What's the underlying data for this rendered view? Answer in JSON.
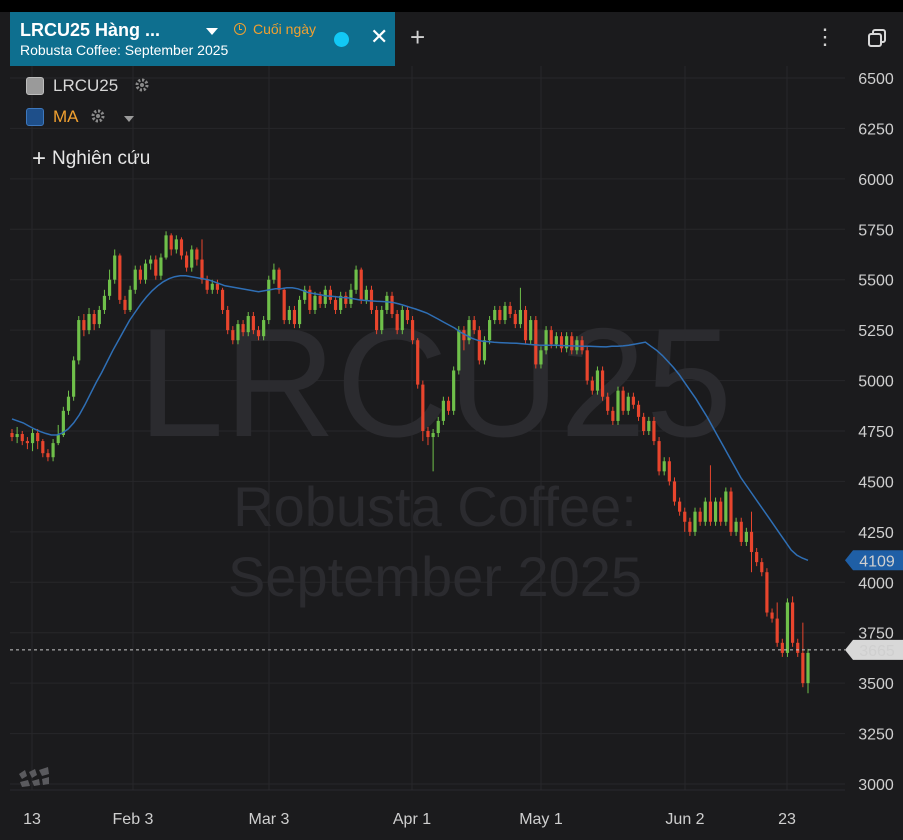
{
  "tab": {
    "title": "LRCU25 Hàng ...",
    "subtitle": "Robusta Coffee: September 2025",
    "timeframe": "Cuối ngày"
  },
  "legend": {
    "series_label": "LRCU25",
    "ma_label": "MA",
    "study_label": "Nghiên cứu",
    "ma_color": "#f0a030"
  },
  "watermark": {
    "symbol": "LRCU25",
    "line1": "Robusta Coffee:",
    "line2": "September 2025"
  },
  "colors": {
    "up": "#6fc04a",
    "down": "#e8452d",
    "ma": "#2f6fb5",
    "tab": "#0e6f8f",
    "last_price_badge": "#1f5fa6"
  },
  "chart_data": {
    "type": "candlestick",
    "y_ticks": [
      3000,
      3250,
      3500,
      3750,
      4000,
      4250,
      4500,
      4750,
      5000,
      5250,
      5500,
      5750,
      6000,
      6250,
      6500
    ],
    "ylim": [
      2950,
      6530
    ],
    "x_labels": [
      "13",
      "Feb 3",
      "Mar 3",
      "Apr 1",
      "May 1",
      "Jun 2",
      "23"
    ],
    "ma_last_value": "4109",
    "last_price_value": "3665",
    "last_price_line": 3665,
    "candles": [
      {
        "o": 4740,
        "c": 4720,
        "h": 4760,
        "l": 4700
      },
      {
        "o": 4720,
        "c": 4735,
        "h": 4770,
        "l": 4690
      },
      {
        "o": 4735,
        "c": 4700,
        "h": 4750,
        "l": 4680
      },
      {
        "o": 4700,
        "c": 4690,
        "h": 4720,
        "l": 4660
      },
      {
        "o": 4690,
        "c": 4740,
        "h": 4760,
        "l": 4650
      },
      {
        "o": 4740,
        "c": 4700,
        "h": 4760,
        "l": 4660
      },
      {
        "o": 4700,
        "c": 4640,
        "h": 4710,
        "l": 4620
      },
      {
        "o": 4640,
        "c": 4620,
        "h": 4660,
        "l": 4600
      },
      {
        "o": 4620,
        "c": 4690,
        "h": 4710,
        "l": 4600
      },
      {
        "o": 4690,
        "c": 4730,
        "h": 4780,
        "l": 4680
      },
      {
        "o": 4730,
        "c": 4850,
        "h": 4870,
        "l": 4720
      },
      {
        "o": 4850,
        "c": 4920,
        "h": 4950,
        "l": 4830
      },
      {
        "o": 4920,
        "c": 5100,
        "h": 5120,
        "l": 4900
      },
      {
        "o": 5100,
        "c": 5300,
        "h": 5320,
        "l": 5080
      },
      {
        "o": 5300,
        "c": 5250,
        "h": 5330,
        "l": 5220
      },
      {
        "o": 5250,
        "c": 5330,
        "h": 5360,
        "l": 5230
      },
      {
        "o": 5330,
        "c": 5280,
        "h": 5350,
        "l": 5250
      },
      {
        "o": 5280,
        "c": 5350,
        "h": 5370,
        "l": 5260
      },
      {
        "o": 5350,
        "c": 5420,
        "h": 5450,
        "l": 5330
      },
      {
        "o": 5420,
        "c": 5500,
        "h": 5550,
        "l": 5400
      },
      {
        "o": 5500,
        "c": 5620,
        "h": 5650,
        "l": 5480
      },
      {
        "o": 5620,
        "c": 5400,
        "h": 5630,
        "l": 5380
      },
      {
        "o": 5400,
        "c": 5350,
        "h": 5420,
        "l": 5330
      },
      {
        "o": 5350,
        "c": 5450,
        "h": 5470,
        "l": 5340
      },
      {
        "o": 5450,
        "c": 5550,
        "h": 5570,
        "l": 5430
      },
      {
        "o": 5550,
        "c": 5500,
        "h": 5570,
        "l": 5480
      },
      {
        "o": 5500,
        "c": 5580,
        "h": 5600,
        "l": 5480
      },
      {
        "o": 5580,
        "c": 5600,
        "h": 5620,
        "l": 5550
      },
      {
        "o": 5600,
        "c": 5520,
        "h": 5620,
        "l": 5500
      },
      {
        "o": 5520,
        "c": 5610,
        "h": 5630,
        "l": 5500
      },
      {
        "o": 5610,
        "c": 5720,
        "h": 5740,
        "l": 5600
      },
      {
        "o": 5720,
        "c": 5650,
        "h": 5730,
        "l": 5620
      },
      {
        "o": 5650,
        "c": 5700,
        "h": 5720,
        "l": 5630
      },
      {
        "o": 5700,
        "c": 5620,
        "h": 5710,
        "l": 5600
      },
      {
        "o": 5620,
        "c": 5560,
        "h": 5640,
        "l": 5540
      },
      {
        "o": 5560,
        "c": 5650,
        "h": 5670,
        "l": 5540
      },
      {
        "o": 5650,
        "c": 5600,
        "h": 5660,
        "l": 5570
      },
      {
        "o": 5600,
        "c": 5500,
        "h": 5700,
        "l": 5480
      },
      {
        "o": 5500,
        "c": 5450,
        "h": 5520,
        "l": 5430
      },
      {
        "o": 5450,
        "c": 5480,
        "h": 5500,
        "l": 5430
      },
      {
        "o": 5480,
        "c": 5450,
        "h": 5500,
        "l": 5430
      },
      {
        "o": 5450,
        "c": 5350,
        "h": 5460,
        "l": 5330
      },
      {
        "o": 5350,
        "c": 5250,
        "h": 5370,
        "l": 5230
      },
      {
        "o": 5250,
        "c": 5200,
        "h": 5270,
        "l": 5180
      },
      {
        "o": 5200,
        "c": 5280,
        "h": 5300,
        "l": 5180
      },
      {
        "o": 5280,
        "c": 5240,
        "h": 5300,
        "l": 5220
      },
      {
        "o": 5240,
        "c": 5320,
        "h": 5340,
        "l": 5220
      },
      {
        "o": 5320,
        "c": 5250,
        "h": 5340,
        "l": 5230
      },
      {
        "o": 5250,
        "c": 5220,
        "h": 5270,
        "l": 5200
      },
      {
        "o": 5220,
        "c": 5300,
        "h": 5320,
        "l": 5200
      },
      {
        "o": 5300,
        "c": 5500,
        "h": 5520,
        "l": 5280
      },
      {
        "o": 5500,
        "c": 5550,
        "h": 5580,
        "l": 5480
      },
      {
        "o": 5550,
        "c": 5450,
        "h": 5560,
        "l": 5430
      },
      {
        "o": 5450,
        "c": 5300,
        "h": 5460,
        "l": 5280
      },
      {
        "o": 5300,
        "c": 5350,
        "h": 5370,
        "l": 5280
      },
      {
        "o": 5350,
        "c": 5280,
        "h": 5370,
        "l": 5260
      },
      {
        "o": 5280,
        "c": 5400,
        "h": 5420,
        "l": 5260
      },
      {
        "o": 5400,
        "c": 5450,
        "h": 5470,
        "l": 5380
      },
      {
        "o": 5450,
        "c": 5350,
        "h": 5470,
        "l": 5330
      },
      {
        "o": 5350,
        "c": 5420,
        "h": 5440,
        "l": 5330
      },
      {
        "o": 5420,
        "c": 5380,
        "h": 5440,
        "l": 5360
      },
      {
        "o": 5380,
        "c": 5450,
        "h": 5470,
        "l": 5360
      },
      {
        "o": 5450,
        "c": 5400,
        "h": 5470,
        "l": 5380
      },
      {
        "o": 5400,
        "c": 5350,
        "h": 5420,
        "l": 5330
      },
      {
        "o": 5350,
        "c": 5420,
        "h": 5440,
        "l": 5330
      },
      {
        "o": 5420,
        "c": 5380,
        "h": 5440,
        "l": 5360
      },
      {
        "o": 5380,
        "c": 5450,
        "h": 5480,
        "l": 5360
      },
      {
        "o": 5450,
        "c": 5550,
        "h": 5570,
        "l": 5430
      },
      {
        "o": 5550,
        "c": 5400,
        "h": 5560,
        "l": 5380
      },
      {
        "o": 5400,
        "c": 5450,
        "h": 5470,
        "l": 5380
      },
      {
        "o": 5450,
        "c": 5350,
        "h": 5470,
        "l": 5330
      },
      {
        "o": 5350,
        "c": 5250,
        "h": 5370,
        "l": 5230
      },
      {
        "o": 5250,
        "c": 5350,
        "h": 5370,
        "l": 5230
      },
      {
        "o": 5350,
        "c": 5420,
        "h": 5440,
        "l": 5330
      },
      {
        "o": 5420,
        "c": 5330,
        "h": 5440,
        "l": 5310
      },
      {
        "o": 5330,
        "c": 5250,
        "h": 5350,
        "l": 5230
      },
      {
        "o": 5250,
        "c": 5350,
        "h": 5370,
        "l": 5230
      },
      {
        "o": 5350,
        "c": 5300,
        "h": 5370,
        "l": 5280
      },
      {
        "o": 5300,
        "c": 5200,
        "h": 5320,
        "l": 5180
      },
      {
        "o": 5200,
        "c": 4980,
        "h": 5210,
        "l": 4960
      },
      {
        "o": 4980,
        "c": 4750,
        "h": 5000,
        "l": 4700
      },
      {
        "o": 4750,
        "c": 4720,
        "h": 4770,
        "l": 4680
      },
      {
        "o": 4720,
        "c": 4740,
        "h": 4760,
        "l": 4550
      },
      {
        "o": 4740,
        "c": 4800,
        "h": 4820,
        "l": 4720
      },
      {
        "o": 4800,
        "c": 4900,
        "h": 4920,
        "l": 4780
      },
      {
        "o": 4900,
        "c": 4850,
        "h": 4920,
        "l": 4830
      },
      {
        "o": 4850,
        "c": 5050,
        "h": 5070,
        "l": 4830
      },
      {
        "o": 5050,
        "c": 5250,
        "h": 5270,
        "l": 5030
      },
      {
        "o": 5250,
        "c": 5200,
        "h": 5270,
        "l": 5150
      },
      {
        "o": 5200,
        "c": 5300,
        "h": 5320,
        "l": 5180
      },
      {
        "o": 5300,
        "c": 5250,
        "h": 5320,
        "l": 5230
      },
      {
        "o": 5250,
        "c": 5100,
        "h": 5270,
        "l": 5080
      },
      {
        "o": 5100,
        "c": 5200,
        "h": 5220,
        "l": 5080
      },
      {
        "o": 5200,
        "c": 5300,
        "h": 5320,
        "l": 5180
      },
      {
        "o": 5300,
        "c": 5350,
        "h": 5370,
        "l": 5280
      },
      {
        "o": 5350,
        "c": 5300,
        "h": 5370,
        "l": 5280
      },
      {
        "o": 5300,
        "c": 5370,
        "h": 5390,
        "l": 5280
      },
      {
        "o": 5370,
        "c": 5330,
        "h": 5390,
        "l": 5310
      },
      {
        "o": 5330,
        "c": 5280,
        "h": 5350,
        "l": 5260
      },
      {
        "o": 5280,
        "c": 5350,
        "h": 5460,
        "l": 5260
      },
      {
        "o": 5350,
        "c": 5200,
        "h": 5370,
        "l": 5180
      },
      {
        "o": 5200,
        "c": 5300,
        "h": 5320,
        "l": 5180
      },
      {
        "o": 5300,
        "c": 5080,
        "h": 5320,
        "l": 5060
      },
      {
        "o": 5080,
        "c": 5150,
        "h": 5170,
        "l": 5060
      },
      {
        "o": 5150,
        "c": 5250,
        "h": 5270,
        "l": 5130
      },
      {
        "o": 5250,
        "c": 5180,
        "h": 5270,
        "l": 5160
      },
      {
        "o": 5180,
        "c": 5220,
        "h": 5240,
        "l": 5160
      },
      {
        "o": 5220,
        "c": 5160,
        "h": 5240,
        "l": 5140
      },
      {
        "o": 5160,
        "c": 5220,
        "h": 5240,
        "l": 5140
      },
      {
        "o": 5220,
        "c": 5150,
        "h": 5240,
        "l": 5130
      },
      {
        "o": 5150,
        "c": 5200,
        "h": 5220,
        "l": 5130
      },
      {
        "o": 5200,
        "c": 5150,
        "h": 5220,
        "l": 5130
      },
      {
        "o": 5150,
        "c": 5000,
        "h": 5170,
        "l": 4980
      },
      {
        "o": 5000,
        "c": 4950,
        "h": 5020,
        "l": 4930
      },
      {
        "o": 4950,
        "c": 5050,
        "h": 5070,
        "l": 4930
      },
      {
        "o": 5050,
        "c": 4920,
        "h": 5070,
        "l": 4900
      },
      {
        "o": 4920,
        "c": 4850,
        "h": 4940,
        "l": 4830
      },
      {
        "o": 4850,
        "c": 4800,
        "h": 4870,
        "l": 4780
      },
      {
        "o": 4800,
        "c": 4950,
        "h": 4970,
        "l": 4780
      },
      {
        "o": 4950,
        "c": 4850,
        "h": 4970,
        "l": 4830
      },
      {
        "o": 4850,
        "c": 4920,
        "h": 4940,
        "l": 4830
      },
      {
        "o": 4920,
        "c": 4880,
        "h": 4940,
        "l": 4860
      },
      {
        "o": 4880,
        "c": 4820,
        "h": 4900,
        "l": 4800
      },
      {
        "o": 4820,
        "c": 4750,
        "h": 4840,
        "l": 4730
      },
      {
        "o": 4750,
        "c": 4800,
        "h": 4820,
        "l": 4730
      },
      {
        "o": 4800,
        "c": 4700,
        "h": 4820,
        "l": 4680
      },
      {
        "o": 4700,
        "c": 4550,
        "h": 4720,
        "l": 4530
      },
      {
        "o": 4550,
        "c": 4600,
        "h": 4620,
        "l": 4530
      },
      {
        "o": 4600,
        "c": 4500,
        "h": 4620,
        "l": 4480
      },
      {
        "o": 4500,
        "c": 4400,
        "h": 4520,
        "l": 4380
      },
      {
        "o": 4400,
        "c": 4350,
        "h": 4420,
        "l": 4330
      },
      {
        "o": 4350,
        "c": 4300,
        "h": 4370,
        "l": 4250
      },
      {
        "o": 4300,
        "c": 4250,
        "h": 4320,
        "l": 4230
      },
      {
        "o": 4250,
        "c": 4350,
        "h": 4370,
        "l": 4230
      },
      {
        "o": 4350,
        "c": 4300,
        "h": 4370,
        "l": 4280
      },
      {
        "o": 4300,
        "c": 4400,
        "h": 4420,
        "l": 4280
      },
      {
        "o": 4400,
        "c": 4300,
        "h": 4580,
        "l": 4280
      },
      {
        "o": 4300,
        "c": 4400,
        "h": 4420,
        "l": 4280
      },
      {
        "o": 4400,
        "c": 4300,
        "h": 4420,
        "l": 4280
      },
      {
        "o": 4300,
        "c": 4450,
        "h": 4470,
        "l": 4280
      },
      {
        "o": 4450,
        "c": 4250,
        "h": 4470,
        "l": 4230
      },
      {
        "o": 4250,
        "c": 4300,
        "h": 4320,
        "l": 4230
      },
      {
        "o": 4300,
        "c": 4200,
        "h": 4320,
        "l": 4180
      },
      {
        "o": 4200,
        "c": 4250,
        "h": 4270,
        "l": 4180
      },
      {
        "o": 4250,
        "c": 4150,
        "h": 4350,
        "l": 4050
      },
      {
        "o": 4150,
        "c": 4100,
        "h": 4170,
        "l": 4080
      },
      {
        "o": 4100,
        "c": 4050,
        "h": 4120,
        "l": 4030
      },
      {
        "o": 4050,
        "c": 3850,
        "h": 4070,
        "l": 3830
      },
      {
        "o": 3850,
        "c": 3820,
        "h": 3870,
        "l": 3800
      },
      {
        "o": 3820,
        "c": 3700,
        "h": 3900,
        "l": 3680
      },
      {
        "o": 3700,
        "c": 3650,
        "h": 3720,
        "l": 3630
      },
      {
        "o": 3650,
        "c": 3900,
        "h": 3920,
        "l": 3630
      },
      {
        "o": 3900,
        "c": 3700,
        "h": 3930,
        "l": 3680
      },
      {
        "o": 3700,
        "c": 3650,
        "h": 3720,
        "l": 3630
      },
      {
        "o": 3650,
        "c": 3500,
        "h": 3800,
        "l": 3480
      },
      {
        "o": 3500,
        "c": 3650,
        "h": 3670,
        "l": 3450
      }
    ],
    "ma": [
      4810,
      4800,
      4790,
      4775,
      4760,
      4748,
      4738,
      4730,
      4730,
      4740,
      4760,
      4790,
      4830,
      4880,
      4935,
      4990,
      5040,
      5095,
      5150,
      5200,
      5250,
      5300,
      5340,
      5380,
      5415,
      5445,
      5470,
      5490,
      5505,
      5515,
      5520,
      5520,
      5515,
      5510,
      5505,
      5500,
      5490,
      5480,
      5470,
      5465,
      5460,
      5455,
      5450,
      5445,
      5440,
      5445,
      5450,
      5455,
      5455,
      5460,
      5460,
      5455,
      5445,
      5435,
      5430,
      5425,
      5420,
      5418,
      5415,
      5412,
      5410,
      5405,
      5400,
      5397,
      5395,
      5393,
      5392,
      5390,
      5387,
      5380,
      5372,
      5363,
      5355,
      5345,
      5335,
      5320,
      5305,
      5290,
      5275,
      5260,
      5240,
      5225,
      5210,
      5200,
      5195,
      5193,
      5190,
      5188,
      5187,
      5186,
      5185,
      5183,
      5180,
      5178,
      5176,
      5175,
      5175,
      5175,
      5174,
      5173,
      5172,
      5171,
      5170,
      5170,
      5169,
      5168,
      5167,
      5170,
      5170,
      5172,
      5175,
      5180,
      5185,
      5190,
      5170,
      5150,
      5125,
      5095,
      5065,
      5030,
      4990,
      4950,
      4910,
      4865,
      4820,
      4770,
      4720,
      4670,
      4620,
      4570,
      4520,
      4480,
      4440,
      4400,
      4360,
      4320,
      4280,
      4240,
      4200,
      4160,
      4135,
      4120,
      4109
    ]
  }
}
